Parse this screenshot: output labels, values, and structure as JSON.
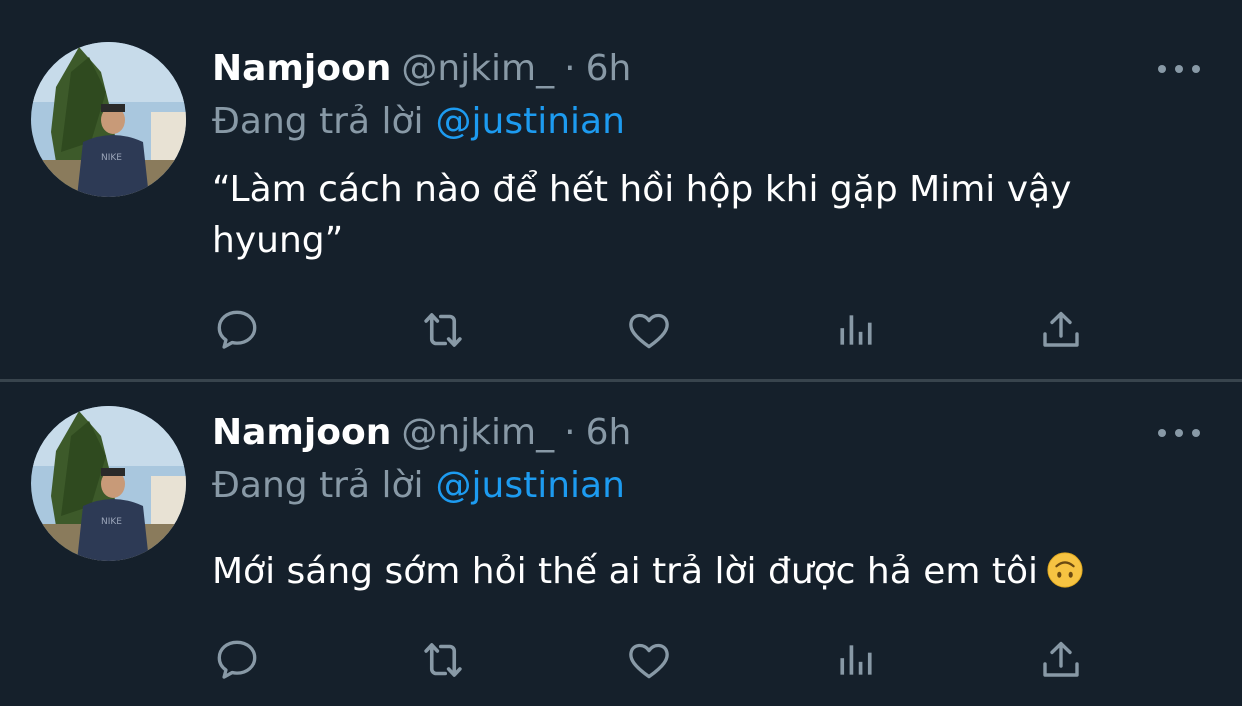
{
  "tweets": [
    {
      "name": "Namjoon",
      "handle": "@njkim_",
      "dot": "·",
      "time": "6h",
      "reply_prefix": "Đang trả lời",
      "reply_to": "@justinian",
      "text": "“Làm cách nào để hết hồi hộp khi gặp Mimi vậy hyung”",
      "emoji": ""
    },
    {
      "name": "Namjoon",
      "handle": "@njkim_",
      "dot": "·",
      "time": "6h",
      "reply_prefix": "Đang trả lời",
      "reply_to": "@justinian",
      "text": "Mới sáng sớm hỏi thế ai trả lời được hả em tôi",
      "emoji": "upside-down-face"
    }
  ],
  "icons": {
    "more": "more-horizontal-icon",
    "reply": "reply-bubble-icon",
    "retweet": "retweet-icon",
    "like": "heart-icon",
    "stats": "analytics-bars-icon",
    "share": "share-upload-icon"
  },
  "colors": {
    "background": "#15202b",
    "divider": "#38444d",
    "muted": "#8899a6",
    "accent": "#1d9bf0",
    "text": "#ffffff"
  }
}
